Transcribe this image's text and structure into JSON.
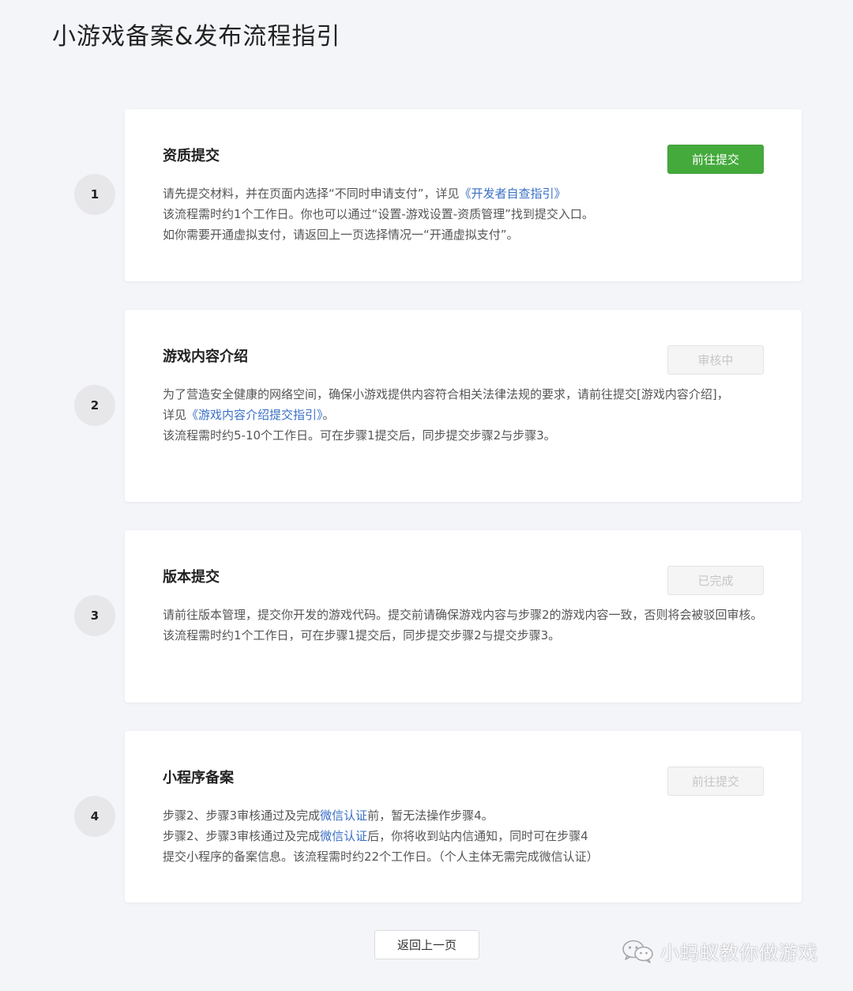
{
  "page": {
    "title": "小游戏备案&发布流程指引"
  },
  "steps": [
    {
      "number": "1",
      "title": "资质提交",
      "button": "前往提交",
      "line1_text": "请先提交材料，并在页面内选择“不同时申请支付”，详见",
      "line1_link": "《开发者自查指引》",
      "line2": "该流程需时约1个工作日。你也可以通过“设置-游戏设置-资质管理”找到提交入口。",
      "line3": "如你需要开通虚拟支付，请返回上一页选择情况一“开通虚拟支付”。"
    },
    {
      "number": "2",
      "title": "游戏内容介绍",
      "button": "审核中",
      "line1": "为了营造安全健康的网络空间，确保小游戏提供内容符合相关法律法规的要求，请前往提交[游戏内容介绍]，",
      "line2_prefix": "详见",
      "line2_link": "《游戏内容介绍提交指引》",
      "line2_suffix": "。",
      "line3": "该流程需时约5-10个工作日。可在步骤1提交后，同步提交步骤2与步骤3。"
    },
    {
      "number": "3",
      "title": "版本提交",
      "button": "已完成",
      "line1": "请前往版本管理，提交你开发的游戏代码。提交前请确保游戏内容与步骤2的游戏内容一致，否则将会被驳回审核。",
      "line2": "该流程需时约1个工作日，可在步骤1提交后，同步提交步骤2与提交步骤3。"
    },
    {
      "number": "4",
      "title": "小程序备案",
      "button": "前往提交",
      "line1_prefix": "步骤2、步骤3审核通过及完成",
      "line1_link": "微信认证",
      "line1_suffix": "前，暂无法操作步骤4。",
      "line2_prefix": "步骤2、步骤3审核通过及完成",
      "line2_link": "微信认证",
      "line2_suffix": "后，你将收到站内信通知，同时可在步骤4",
      "line3": "提交小程序的备案信息。该流程需时约22个工作日。（个人主体无需完成微信认证）"
    }
  ],
  "footer": {
    "back_button": "返回上一页",
    "watermark": "小蚂蚁教你做游戏",
    "watermark_icon": "wechat-icon"
  },
  "colors": {
    "primary_green": "#44aa3c",
    "link_blue": "#3a6fc6",
    "background": "#f4f5f9"
  }
}
